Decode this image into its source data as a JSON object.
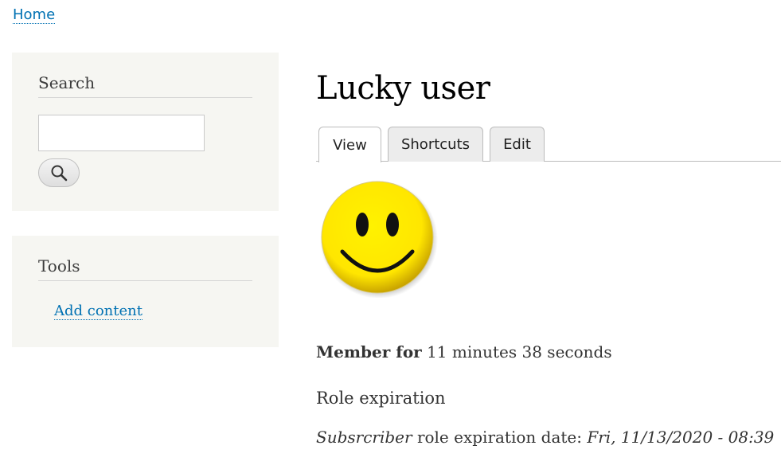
{
  "breadcrumb": {
    "home_label": "Home"
  },
  "sidebar": {
    "search": {
      "title": "Search",
      "input_value": "",
      "button_icon": "search-icon"
    },
    "tools": {
      "title": "Tools",
      "links": [
        {
          "label": "Add content"
        }
      ]
    }
  },
  "main": {
    "title": "Lucky user",
    "tabs": [
      {
        "label": "View",
        "active": true
      },
      {
        "label": "Shortcuts",
        "active": false
      },
      {
        "label": "Edit",
        "active": false
      }
    ],
    "avatar_icon": "smiley-face-icon",
    "member_for": {
      "label": "Member for",
      "value": "11 minutes 38 seconds"
    },
    "role_expiration": {
      "heading": "Role expiration",
      "role_name": "Subsrcriber",
      "text": "role expiration date:",
      "date": "Fri, 11/13/2020 - 08:39"
    }
  },
  "colors": {
    "link": "#0071b3",
    "sidebar_bg": "#f6f6f2",
    "tab_bg": "#ececec"
  }
}
